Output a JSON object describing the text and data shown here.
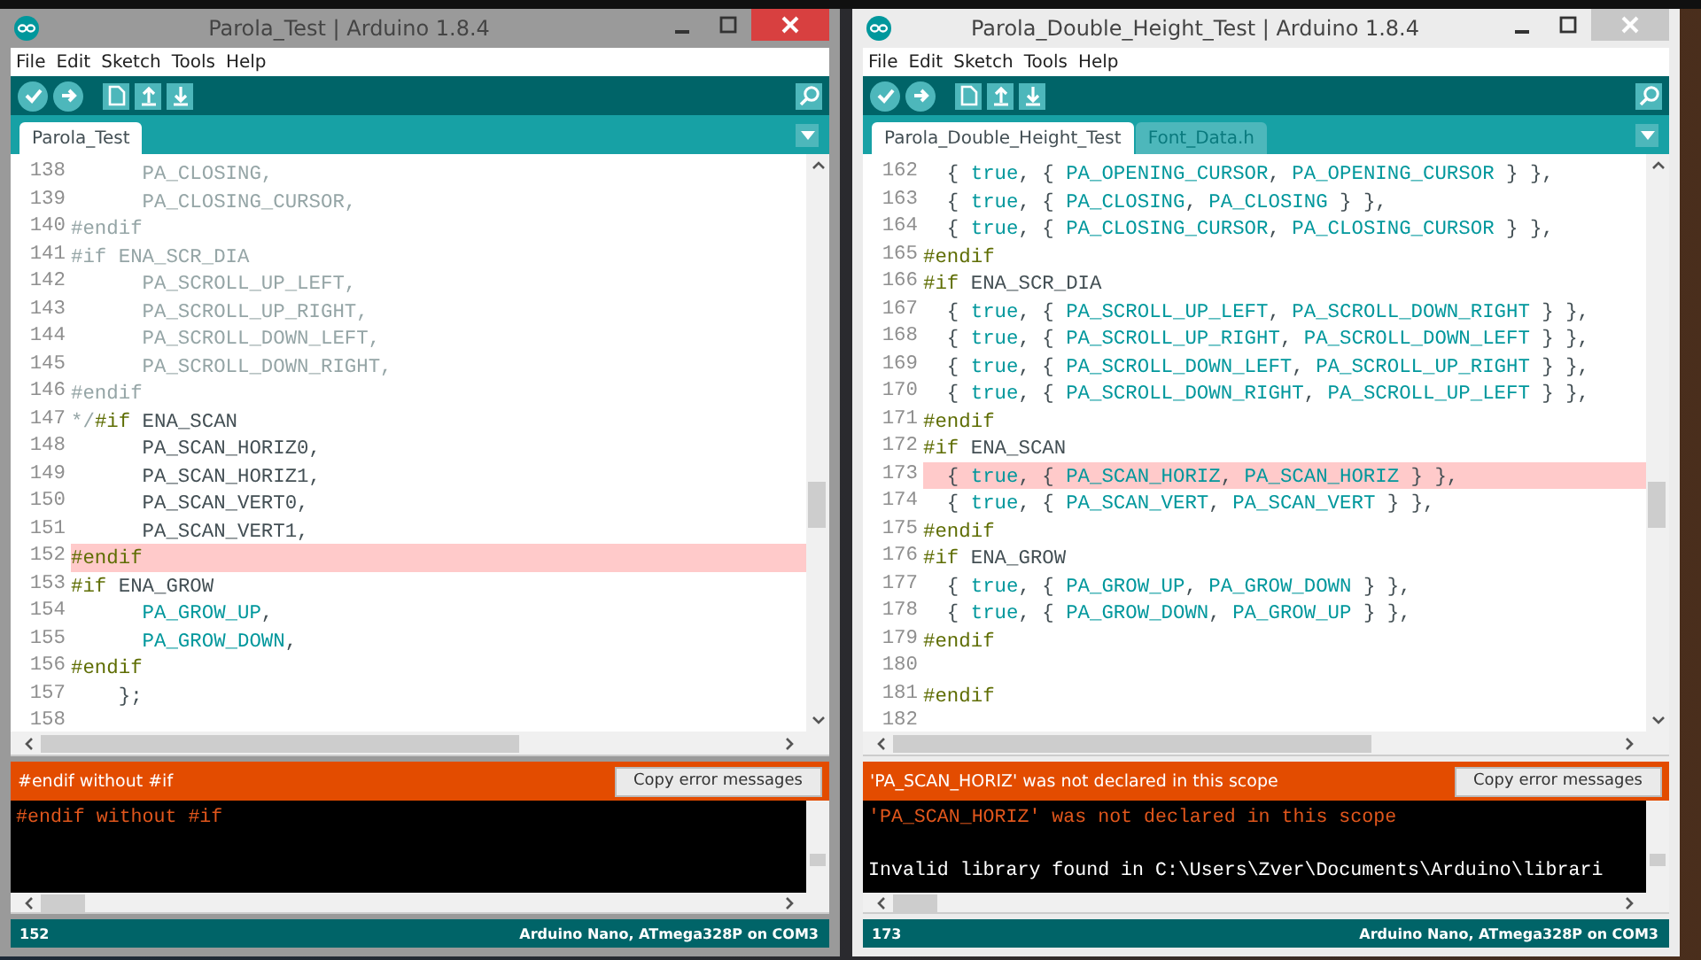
{
  "windows": [
    {
      "title": "Parola_Test | Arduino 1.8.4",
      "active": true,
      "menu": [
        "File",
        "Edit",
        "Sketch",
        "Tools",
        "Help"
      ],
      "tabs": [
        {
          "label": "Parola_Test",
          "selected": true
        }
      ],
      "lines": [
        {
          "number": "138",
          "highlighted": false,
          "tokens": [
            {
              "kind": "comment",
              "text": "      PA_CLOSING,"
            }
          ]
        },
        {
          "number": "139",
          "highlighted": false,
          "tokens": [
            {
              "kind": "comment",
              "text": "      PA_CLOSING_CURSOR,"
            }
          ]
        },
        {
          "number": "140",
          "highlighted": false,
          "tokens": [
            {
              "kind": "comment",
              "text": "#endif"
            }
          ]
        },
        {
          "number": "141",
          "highlighted": false,
          "tokens": [
            {
              "kind": "comment",
              "text": "#if ENA_SCR_DIA"
            }
          ]
        },
        {
          "number": "142",
          "highlighted": false,
          "tokens": [
            {
              "kind": "comment",
              "text": "      PA_SCROLL_UP_LEFT,"
            }
          ]
        },
        {
          "number": "143",
          "highlighted": false,
          "tokens": [
            {
              "kind": "comment",
              "text": "      PA_SCROLL_UP_RIGHT,"
            }
          ]
        },
        {
          "number": "144",
          "highlighted": false,
          "tokens": [
            {
              "kind": "comment",
              "text": "      PA_SCROLL_DOWN_LEFT,"
            }
          ]
        },
        {
          "number": "145",
          "highlighted": false,
          "tokens": [
            {
              "kind": "comment",
              "text": "      PA_SCROLL_DOWN_RIGHT,"
            }
          ]
        },
        {
          "number": "146",
          "highlighted": false,
          "tokens": [
            {
              "kind": "comment",
              "text": "#endif"
            }
          ]
        },
        {
          "number": "147",
          "highlighted": false,
          "tokens": [
            {
              "kind": "comment",
              "text": "*/"
            },
            {
              "kind": "preproc",
              "text": "#if"
            },
            {
              "kind": "plain",
              "text": " ENA_SCAN"
            }
          ]
        },
        {
          "number": "148",
          "highlighted": false,
          "tokens": [
            {
              "kind": "plain",
              "text": "      PA_SCAN_HORIZ0,"
            }
          ]
        },
        {
          "number": "149",
          "highlighted": false,
          "tokens": [
            {
              "kind": "plain",
              "text": "      PA_SCAN_HORIZ1,"
            }
          ]
        },
        {
          "number": "150",
          "highlighted": false,
          "tokens": [
            {
              "kind": "plain",
              "text": "      PA_SCAN_VERT0,"
            }
          ]
        },
        {
          "number": "151",
          "highlighted": false,
          "tokens": [
            {
              "kind": "plain",
              "text": "      PA_SCAN_VERT1,"
            }
          ]
        },
        {
          "number": "152",
          "highlighted": true,
          "tokens": [
            {
              "kind": "preproc",
              "text": "#endif"
            }
          ]
        },
        {
          "number": "153",
          "highlighted": false,
          "tokens": [
            {
              "kind": "preproc",
              "text": "#if"
            },
            {
              "kind": "plain",
              "text": " ENA_GROW"
            }
          ]
        },
        {
          "number": "154",
          "highlighted": false,
          "tokens": [
            {
              "kind": "const",
              "text": "      PA_GROW_UP"
            },
            {
              "kind": "plain",
              "text": ","
            }
          ]
        },
        {
          "number": "155",
          "highlighted": false,
          "tokens": [
            {
              "kind": "const",
              "text": "      PA_GROW_DOWN"
            },
            {
              "kind": "plain",
              "text": ","
            }
          ]
        },
        {
          "number": "156",
          "highlighted": false,
          "tokens": [
            {
              "kind": "preproc",
              "text": "#endif"
            }
          ]
        },
        {
          "number": "157",
          "highlighted": false,
          "tokens": [
            {
              "kind": "plain",
              "text": "    };"
            }
          ]
        },
        {
          "number": "158",
          "highlighted": false
        }
      ],
      "error_bar": {
        "message": "#endif without #if",
        "button": "Copy error messages"
      },
      "console": [
        {
          "kind": "error",
          "text": "#endif without #if"
        }
      ],
      "status": {
        "line": "152",
        "board": "Arduino Nano, ATmega328P on COM3"
      }
    },
    {
      "title": "Parola_Double_Height_Test | Arduino 1.8.4",
      "active": false,
      "menu": [
        "File",
        "Edit",
        "Sketch",
        "Tools",
        "Help"
      ],
      "tabs": [
        {
          "label": "Parola_Double_Height_Test",
          "selected": true
        },
        {
          "label": "Font_Data.h",
          "selected": false
        }
      ],
      "lines": [
        {
          "number": "162",
          "highlighted": false,
          "tokens": [
            {
              "kind": "plain",
              "text": "  { "
            },
            {
              "kind": "const",
              "text": "true"
            },
            {
              "kind": "plain",
              "text": ", { "
            },
            {
              "kind": "const",
              "text": "PA_OPENING_CURSOR"
            },
            {
              "kind": "plain",
              "text": ", "
            },
            {
              "kind": "const",
              "text": "PA_OPENING_CURSOR"
            },
            {
              "kind": "plain",
              "text": " } },"
            }
          ]
        },
        {
          "number": "163",
          "highlighted": false,
          "tokens": [
            {
              "kind": "plain",
              "text": "  { "
            },
            {
              "kind": "const",
              "text": "true"
            },
            {
              "kind": "plain",
              "text": ", { "
            },
            {
              "kind": "const",
              "text": "PA_CLOSING"
            },
            {
              "kind": "plain",
              "text": ", "
            },
            {
              "kind": "const",
              "text": "PA_CLOSING"
            },
            {
              "kind": "plain",
              "text": " } },"
            }
          ]
        },
        {
          "number": "164",
          "highlighted": false,
          "tokens": [
            {
              "kind": "plain",
              "text": "  { "
            },
            {
              "kind": "const",
              "text": "true"
            },
            {
              "kind": "plain",
              "text": ", { "
            },
            {
              "kind": "const",
              "text": "PA_CLOSING_CURSOR"
            },
            {
              "kind": "plain",
              "text": ", "
            },
            {
              "kind": "const",
              "text": "PA_CLOSING_CURSOR"
            },
            {
              "kind": "plain",
              "text": " } },"
            }
          ]
        },
        {
          "number": "165",
          "highlighted": false,
          "tokens": [
            {
              "kind": "preproc",
              "text": "#endif"
            }
          ]
        },
        {
          "number": "166",
          "highlighted": false,
          "tokens": [
            {
              "kind": "preproc",
              "text": "#if"
            },
            {
              "kind": "plain",
              "text": " ENA_SCR_DIA"
            }
          ]
        },
        {
          "number": "167",
          "highlighted": false,
          "tokens": [
            {
              "kind": "plain",
              "text": "  { "
            },
            {
              "kind": "const",
              "text": "true"
            },
            {
              "kind": "plain",
              "text": ", { "
            },
            {
              "kind": "const",
              "text": "PA_SCROLL_UP_LEFT"
            },
            {
              "kind": "plain",
              "text": ", "
            },
            {
              "kind": "const",
              "text": "PA_SCROLL_DOWN_RIGHT"
            },
            {
              "kind": "plain",
              "text": " } },"
            }
          ]
        },
        {
          "number": "168",
          "highlighted": false,
          "tokens": [
            {
              "kind": "plain",
              "text": "  { "
            },
            {
              "kind": "const",
              "text": "true"
            },
            {
              "kind": "plain",
              "text": ", { "
            },
            {
              "kind": "const",
              "text": "PA_SCROLL_UP_RIGHT"
            },
            {
              "kind": "plain",
              "text": ", "
            },
            {
              "kind": "const",
              "text": "PA_SCROLL_DOWN_LEFT"
            },
            {
              "kind": "plain",
              "text": " } },"
            }
          ]
        },
        {
          "number": "169",
          "highlighted": false,
          "tokens": [
            {
              "kind": "plain",
              "text": "  { "
            },
            {
              "kind": "const",
              "text": "true"
            },
            {
              "kind": "plain",
              "text": ", { "
            },
            {
              "kind": "const",
              "text": "PA_SCROLL_DOWN_LEFT"
            },
            {
              "kind": "plain",
              "text": ", "
            },
            {
              "kind": "const",
              "text": "PA_SCROLL_UP_RIGHT"
            },
            {
              "kind": "plain",
              "text": " } },"
            }
          ]
        },
        {
          "number": "170",
          "highlighted": false,
          "tokens": [
            {
              "kind": "plain",
              "text": "  { "
            },
            {
              "kind": "const",
              "text": "true"
            },
            {
              "kind": "plain",
              "text": ", { "
            },
            {
              "kind": "const",
              "text": "PA_SCROLL_DOWN_RIGHT"
            },
            {
              "kind": "plain",
              "text": ", "
            },
            {
              "kind": "const",
              "text": "PA_SCROLL_UP_LEFT"
            },
            {
              "kind": "plain",
              "text": " } },"
            }
          ]
        },
        {
          "number": "171",
          "highlighted": false,
          "tokens": [
            {
              "kind": "preproc",
              "text": "#endif"
            }
          ]
        },
        {
          "number": "172",
          "highlighted": false,
          "tokens": [
            {
              "kind": "preproc",
              "text": "#if"
            },
            {
              "kind": "plain",
              "text": " ENA_SCAN"
            }
          ]
        },
        {
          "number": "173",
          "highlighted": true,
          "tokens": [
            {
              "kind": "plain",
              "text": "  { "
            },
            {
              "kind": "const",
              "text": "true"
            },
            {
              "kind": "plain",
              "text": ", { "
            },
            {
              "kind": "const",
              "text": "PA_SCAN_HORIZ"
            },
            {
              "kind": "plain",
              "text": ", "
            },
            {
              "kind": "const",
              "text": "PA_SCAN_HORIZ"
            },
            {
              "kind": "plain",
              "text": " } },"
            }
          ]
        },
        {
          "number": "174",
          "highlighted": false,
          "tokens": [
            {
              "kind": "plain",
              "text": "  { "
            },
            {
              "kind": "const",
              "text": "true"
            },
            {
              "kind": "plain",
              "text": ", { "
            },
            {
              "kind": "const",
              "text": "PA_SCAN_VERT"
            },
            {
              "kind": "plain",
              "text": ", "
            },
            {
              "kind": "const",
              "text": "PA_SCAN_VERT"
            },
            {
              "kind": "plain",
              "text": " } },"
            }
          ]
        },
        {
          "number": "175",
          "highlighted": false,
          "tokens": [
            {
              "kind": "preproc",
              "text": "#endif"
            }
          ]
        },
        {
          "number": "176",
          "highlighted": false,
          "tokens": [
            {
              "kind": "preproc",
              "text": "#if"
            },
            {
              "kind": "plain",
              "text": " ENA_GROW"
            }
          ]
        },
        {
          "number": "177",
          "highlighted": false,
          "tokens": [
            {
              "kind": "plain",
              "text": "  { "
            },
            {
              "kind": "const",
              "text": "true"
            },
            {
              "kind": "plain",
              "text": ", { "
            },
            {
              "kind": "const",
              "text": "PA_GROW_UP"
            },
            {
              "kind": "plain",
              "text": ", "
            },
            {
              "kind": "const",
              "text": "PA_GROW_DOWN"
            },
            {
              "kind": "plain",
              "text": " } },"
            }
          ]
        },
        {
          "number": "178",
          "highlighted": false,
          "tokens": [
            {
              "kind": "plain",
              "text": "  { "
            },
            {
              "kind": "const",
              "text": "true"
            },
            {
              "kind": "plain",
              "text": ", { "
            },
            {
              "kind": "const",
              "text": "PA_GROW_DOWN"
            },
            {
              "kind": "plain",
              "text": ", "
            },
            {
              "kind": "const",
              "text": "PA_GROW_UP"
            },
            {
              "kind": "plain",
              "text": " } },"
            }
          ]
        },
        {
          "number": "179",
          "highlighted": false,
          "tokens": [
            {
              "kind": "preproc",
              "text": "#endif"
            }
          ]
        },
        {
          "number": "180",
          "highlighted": false
        },
        {
          "number": "181",
          "highlighted": false,
          "tokens": [
            {
              "kind": "preproc",
              "text": "#endif"
            }
          ]
        },
        {
          "number": "182",
          "highlighted": false
        }
      ],
      "error_bar": {
        "message": "'PA_SCAN_HORIZ' was not declared in this scope",
        "button": "Copy error messages"
      },
      "console": [
        {
          "kind": "error",
          "text": "'PA_SCAN_HORIZ' was not declared in this scope"
        },
        {
          "kind": "info",
          "text": "Invalid library found in C:\\Users\\Zver\\Documents\\Arduino\\librari"
        }
      ],
      "status": {
        "line": "173",
        "board": "Arduino Nano, ATmega328P on COM3"
      }
    }
  ]
}
